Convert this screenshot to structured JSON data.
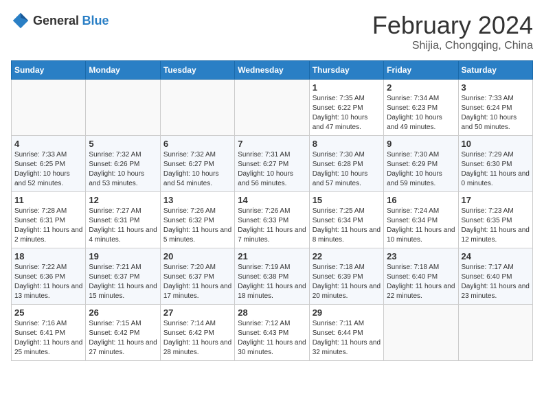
{
  "logo": {
    "general": "General",
    "blue": "Blue"
  },
  "title": "February 2024",
  "subtitle": "Shijia, Chongqing, China",
  "days_of_week": [
    "Sunday",
    "Monday",
    "Tuesday",
    "Wednesday",
    "Thursday",
    "Friday",
    "Saturday"
  ],
  "weeks": [
    [
      {
        "day": "",
        "info": ""
      },
      {
        "day": "",
        "info": ""
      },
      {
        "day": "",
        "info": ""
      },
      {
        "day": "",
        "info": ""
      },
      {
        "day": "1",
        "info": "Sunrise: 7:35 AM\nSunset: 6:22 PM\nDaylight: 10 hours and 47 minutes."
      },
      {
        "day": "2",
        "info": "Sunrise: 7:34 AM\nSunset: 6:23 PM\nDaylight: 10 hours and 49 minutes."
      },
      {
        "day": "3",
        "info": "Sunrise: 7:33 AM\nSunset: 6:24 PM\nDaylight: 10 hours and 50 minutes."
      }
    ],
    [
      {
        "day": "4",
        "info": "Sunrise: 7:33 AM\nSunset: 6:25 PM\nDaylight: 10 hours and 52 minutes."
      },
      {
        "day": "5",
        "info": "Sunrise: 7:32 AM\nSunset: 6:26 PM\nDaylight: 10 hours and 53 minutes."
      },
      {
        "day": "6",
        "info": "Sunrise: 7:32 AM\nSunset: 6:27 PM\nDaylight: 10 hours and 54 minutes."
      },
      {
        "day": "7",
        "info": "Sunrise: 7:31 AM\nSunset: 6:27 PM\nDaylight: 10 hours and 56 minutes."
      },
      {
        "day": "8",
        "info": "Sunrise: 7:30 AM\nSunset: 6:28 PM\nDaylight: 10 hours and 57 minutes."
      },
      {
        "day": "9",
        "info": "Sunrise: 7:30 AM\nSunset: 6:29 PM\nDaylight: 10 hours and 59 minutes."
      },
      {
        "day": "10",
        "info": "Sunrise: 7:29 AM\nSunset: 6:30 PM\nDaylight: 11 hours and 0 minutes."
      }
    ],
    [
      {
        "day": "11",
        "info": "Sunrise: 7:28 AM\nSunset: 6:31 PM\nDaylight: 11 hours and 2 minutes."
      },
      {
        "day": "12",
        "info": "Sunrise: 7:27 AM\nSunset: 6:31 PM\nDaylight: 11 hours and 4 minutes."
      },
      {
        "day": "13",
        "info": "Sunrise: 7:26 AM\nSunset: 6:32 PM\nDaylight: 11 hours and 5 minutes."
      },
      {
        "day": "14",
        "info": "Sunrise: 7:26 AM\nSunset: 6:33 PM\nDaylight: 11 hours and 7 minutes."
      },
      {
        "day": "15",
        "info": "Sunrise: 7:25 AM\nSunset: 6:34 PM\nDaylight: 11 hours and 8 minutes."
      },
      {
        "day": "16",
        "info": "Sunrise: 7:24 AM\nSunset: 6:34 PM\nDaylight: 11 hours and 10 minutes."
      },
      {
        "day": "17",
        "info": "Sunrise: 7:23 AM\nSunset: 6:35 PM\nDaylight: 11 hours and 12 minutes."
      }
    ],
    [
      {
        "day": "18",
        "info": "Sunrise: 7:22 AM\nSunset: 6:36 PM\nDaylight: 11 hours and 13 minutes."
      },
      {
        "day": "19",
        "info": "Sunrise: 7:21 AM\nSunset: 6:37 PM\nDaylight: 11 hours and 15 minutes."
      },
      {
        "day": "20",
        "info": "Sunrise: 7:20 AM\nSunset: 6:37 PM\nDaylight: 11 hours and 17 minutes."
      },
      {
        "day": "21",
        "info": "Sunrise: 7:19 AM\nSunset: 6:38 PM\nDaylight: 11 hours and 18 minutes."
      },
      {
        "day": "22",
        "info": "Sunrise: 7:18 AM\nSunset: 6:39 PM\nDaylight: 11 hours and 20 minutes."
      },
      {
        "day": "23",
        "info": "Sunrise: 7:18 AM\nSunset: 6:40 PM\nDaylight: 11 hours and 22 minutes."
      },
      {
        "day": "24",
        "info": "Sunrise: 7:17 AM\nSunset: 6:40 PM\nDaylight: 11 hours and 23 minutes."
      }
    ],
    [
      {
        "day": "25",
        "info": "Sunrise: 7:16 AM\nSunset: 6:41 PM\nDaylight: 11 hours and 25 minutes."
      },
      {
        "day": "26",
        "info": "Sunrise: 7:15 AM\nSunset: 6:42 PM\nDaylight: 11 hours and 27 minutes."
      },
      {
        "day": "27",
        "info": "Sunrise: 7:14 AM\nSunset: 6:42 PM\nDaylight: 11 hours and 28 minutes."
      },
      {
        "day": "28",
        "info": "Sunrise: 7:12 AM\nSunset: 6:43 PM\nDaylight: 11 hours and 30 minutes."
      },
      {
        "day": "29",
        "info": "Sunrise: 7:11 AM\nSunset: 6:44 PM\nDaylight: 11 hours and 32 minutes."
      },
      {
        "day": "",
        "info": ""
      },
      {
        "day": "",
        "info": ""
      }
    ]
  ]
}
